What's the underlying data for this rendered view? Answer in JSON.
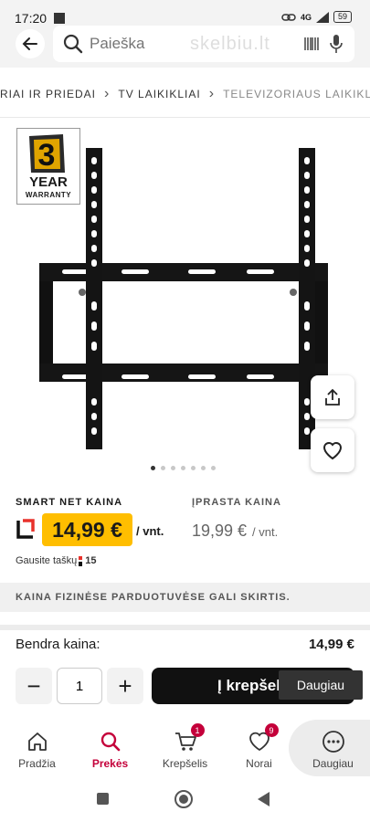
{
  "status_bar": {
    "time": "17:20",
    "network": "4G",
    "battery": "59"
  },
  "header": {
    "back_icon": "arrow-left-icon",
    "search_placeholder": "Paieška",
    "watermark": "skelbiu.lt",
    "barcode_icon": "barcode-icon",
    "mic_icon": "microphone-icon"
  },
  "breadcrumb": {
    "items": [
      "RIAI IR PRIEDAI",
      "TV LAIKIKLIAI",
      "TELEVIZORIAUS LAIKIKL..."
    ]
  },
  "product": {
    "warranty": {
      "digit": "3",
      "line1": "YEAR",
      "line2": "WARRANTY"
    },
    "image_icon": "tv-wall-mount-bracket",
    "share_icon": "share-icon",
    "favorite_icon": "heart-icon",
    "gallery": {
      "count": 7,
      "active_index": 0
    }
  },
  "prices": {
    "smart_label": "SMART NET KAINA",
    "smart_price": "14,99 €",
    "smart_unit": "/ vnt.",
    "regular_label": "ĮPRASTA KAINA",
    "regular_price": "19,99 €",
    "regular_unit": "/ vnt.",
    "points_text": "Gausite taškų",
    "points_value": "15"
  },
  "notice": "KAINA FIZINĖSE PARDUOTUVĖSE GALI SKIRTIS.",
  "summary": {
    "total_label": "Bendra kaina:",
    "total_value": "14,99 €",
    "quantity": "1",
    "minus_label": "−",
    "plus_label": "+",
    "add_to_cart_label": "Į krepšelį",
    "tooltip": "Daugiau"
  },
  "bottom_nav": {
    "items": [
      {
        "label": "Pradžia",
        "icon": "home-icon"
      },
      {
        "label": "Prekės",
        "icon": "search-icon"
      },
      {
        "label": "Krepšelis",
        "icon": "cart-icon",
        "badge": "1"
      },
      {
        "label": "Norai",
        "icon": "heart-icon",
        "badge": "9"
      },
      {
        "label": "Daugiau",
        "icon": "more-icon"
      }
    ],
    "active": "Prekės"
  },
  "colors": {
    "accent": "#c4003a",
    "price_highlight": "#ffbe00",
    "cart_button": "#111111"
  }
}
